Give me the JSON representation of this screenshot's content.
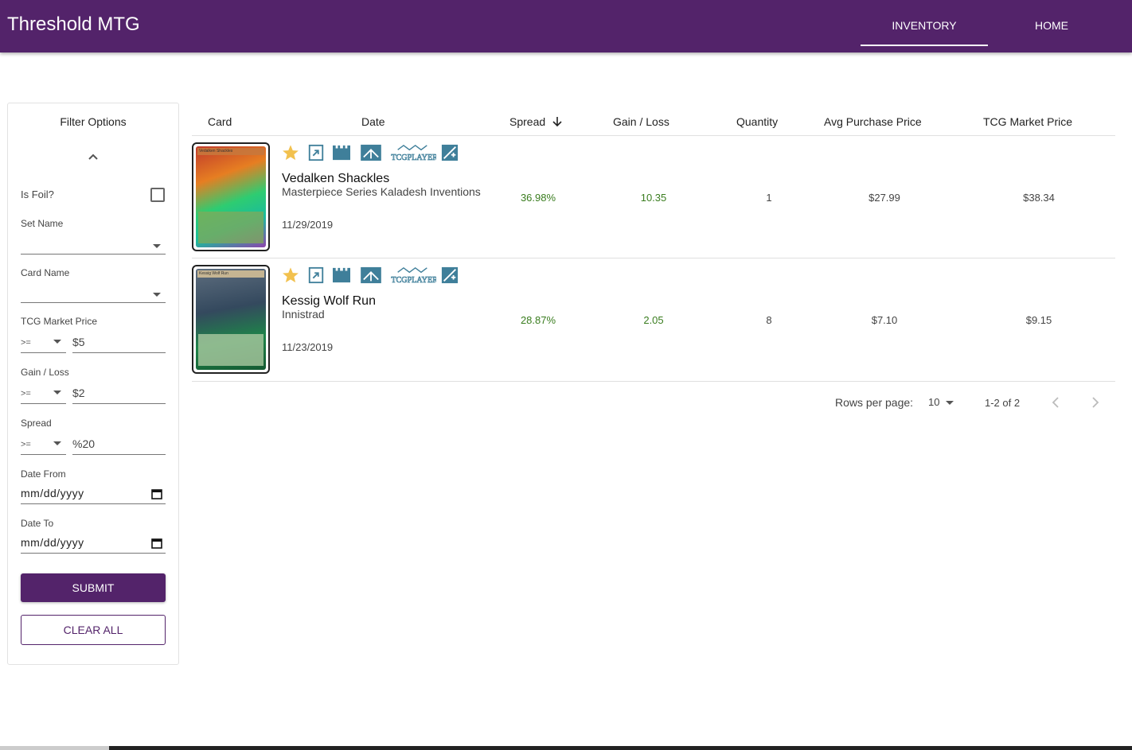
{
  "app": {
    "title": "Threshold MTG"
  },
  "nav": {
    "tabs": [
      {
        "label": "INVENTORY",
        "active": true
      },
      {
        "label": "HOME",
        "active": false
      }
    ]
  },
  "filters": {
    "title": "Filter Options",
    "is_foil_label": "Is Foil?",
    "is_foil_checked": false,
    "set_name_label": "Set Name",
    "card_name_label": "Card Name",
    "tcg_market_price": {
      "label": "TCG Market Price",
      "operator": ">=",
      "value": "$5"
    },
    "gain_loss": {
      "label": "Gain / Loss",
      "operator": ">=",
      "value": "$2"
    },
    "spread": {
      "label": "Spread",
      "operator": ">=",
      "value": "%20"
    },
    "date_from": {
      "label": "Date From",
      "placeholder": "mm/dd/yyyy"
    },
    "date_to": {
      "label": "Date To",
      "placeholder": "mm/dd/yyyy"
    },
    "submit_label": "SUBMIT",
    "clear_label": "CLEAR ALL"
  },
  "table": {
    "columns": [
      "Card",
      "Date",
      "Spread",
      "Gain / Loss",
      "Quantity",
      "Avg Purchase Price",
      "TCG Market Price"
    ],
    "sort_column": "Spread",
    "sort_direction": "descending",
    "rows": [
      {
        "name": "Vedalken Shackles",
        "set": "Masterpiece Series Kaladesh Inventions",
        "date": "11/29/2019",
        "spread": "36.98%",
        "gain_loss": "10.35",
        "quantity": "1",
        "avg_purchase_price": "$27.99",
        "tcg_market_price": "$38.34",
        "card_art_name": "Vedalken Shackles"
      },
      {
        "name": "Kessig Wolf Run",
        "set": "Innistrad",
        "date": "11/23/2019",
        "spread": "28.87%",
        "gain_loss": "2.05",
        "quantity": "8",
        "avg_purchase_price": "$7.10",
        "tcg_market_price": "$9.15",
        "card_art_name": "Kessig Wolf Run"
      }
    ]
  },
  "row_icons": [
    "star-icon",
    "scryfall-icon",
    "castle-icon",
    "book-icon",
    "tcgplayer-logo",
    "edit-plus-icon"
  ],
  "tcgplayer_text": "TCGPLAYER",
  "pagination": {
    "rows_per_page_label": "Rows per page:",
    "rows_per_page": "10",
    "range": "1-2 of 2"
  },
  "colors": {
    "primary": "#53236a",
    "gain": "#3a7d1f",
    "icon": "#3f7f9a",
    "star": "#f2c14e"
  }
}
